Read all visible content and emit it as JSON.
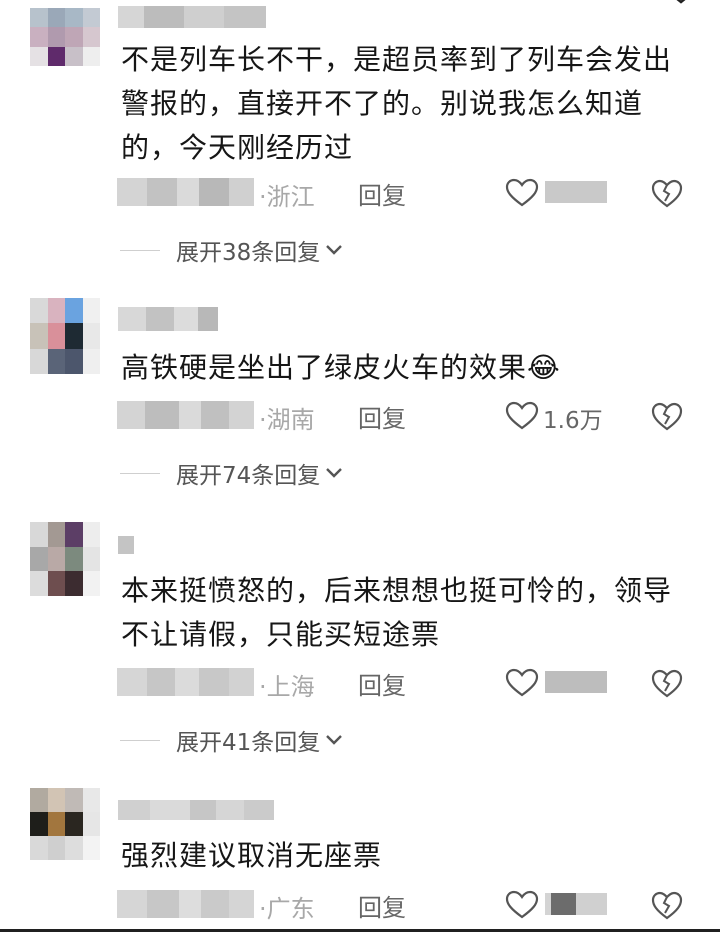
{
  "comments": [
    {
      "text": "不是列车长不干，是超员率到了列车会发出警报的，直接开不了的。别说我怎么知道的，今天刚经历过",
      "region": "·浙江",
      "reply_label": "回复",
      "like_count": "",
      "expand_label": "展开38条回复"
    },
    {
      "text": "高铁硬是坐出了绿皮火车的效果",
      "emoji": "😂",
      "region": "·湖南",
      "reply_label": "回复",
      "like_count": "1.6万",
      "expand_label": "展开74条回复"
    },
    {
      "text": "本来挺愤怒的，后来想想也挺可怜的，领导不让请假，只能买短途票",
      "region": "·上海",
      "reply_label": "回复",
      "like_count": "",
      "expand_label": "展开41条回复"
    },
    {
      "text": "强烈建议取消无座票",
      "region": "·广东",
      "reply_label": "回复",
      "like_count": ""
    }
  ],
  "icons": {
    "like": "heart-outline-icon",
    "dislike": "broken-heart-icon",
    "expand": "chevron-down-icon"
  },
  "colors": {
    "text": "#161616",
    "secondary": "#666666",
    "muted": "#a8a8a8"
  }
}
